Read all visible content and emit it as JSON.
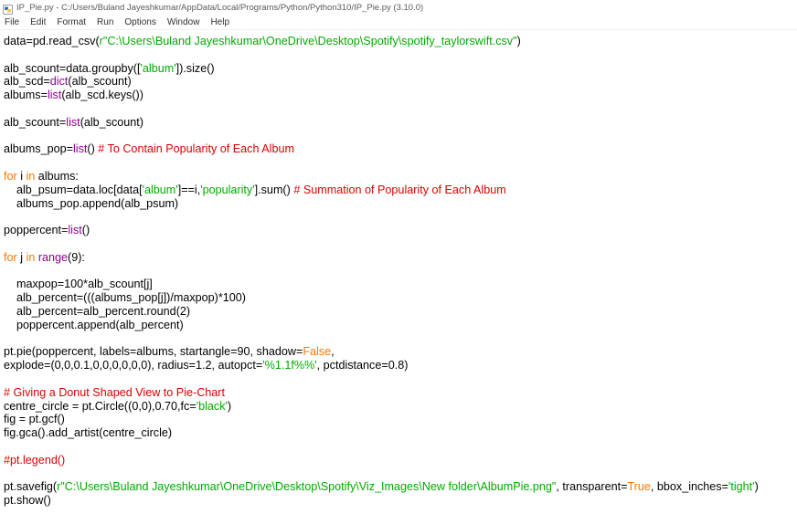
{
  "window": {
    "title": "IP_Pie.py - C:/Users/Buland Jayeshkumar/AppData/Local/Programs/Python/Python310/IP_Pie.py (3.10.0)"
  },
  "menu": {
    "items": [
      "File",
      "Edit",
      "Format",
      "Run",
      "Options",
      "Window",
      "Help"
    ]
  },
  "colors": {
    "keyword": "#ff7700",
    "builtin": "#900090",
    "string": "#00aa00",
    "comment": "#dd0000",
    "default": "#000000"
  },
  "code": {
    "lines": [
      [
        [
          "p",
          "data=pd.read_csv("
        ],
        [
          "s",
          "r\"C:\\Users\\Buland Jayeshkumar\\OneDrive\\Desktop\\Spotify\\spotify_taylorswift.csv\""
        ],
        [
          "p",
          ")"
        ]
      ],
      [],
      [
        [
          "p",
          "alb_scount=data.groupby(["
        ],
        [
          "s",
          "'album'"
        ],
        [
          "p",
          "]).size()"
        ]
      ],
      [
        [
          "p",
          "alb_scd="
        ],
        [
          "b",
          "dict"
        ],
        [
          "p",
          "(alb_scount)"
        ]
      ],
      [
        [
          "p",
          "albums="
        ],
        [
          "b",
          "list"
        ],
        [
          "p",
          "(alb_scd.keys())"
        ]
      ],
      [],
      [
        [
          "p",
          "alb_scount="
        ],
        [
          "b",
          "list"
        ],
        [
          "p",
          "(alb_scount)"
        ]
      ],
      [],
      [
        [
          "p",
          "albums_pop="
        ],
        [
          "b",
          "list"
        ],
        [
          "p",
          "() "
        ],
        [
          "c",
          "# To Contain Popularity of Each Album"
        ]
      ],
      [],
      [
        [
          "k",
          "for"
        ],
        [
          "p",
          " i "
        ],
        [
          "k",
          "in"
        ],
        [
          "p",
          " albums:"
        ]
      ],
      [
        [
          "p",
          "    alb_psum=data.loc[data["
        ],
        [
          "s",
          "'album'"
        ],
        [
          "p",
          "]==i,"
        ],
        [
          "s",
          "'popularity'"
        ],
        [
          "p",
          "].sum() "
        ],
        [
          "c",
          "# Summation of Popularity of Each Album"
        ]
      ],
      [
        [
          "p",
          "    albums_pop.append(alb_psum)"
        ]
      ],
      [],
      [
        [
          "p",
          "poppercent="
        ],
        [
          "b",
          "list"
        ],
        [
          "p",
          "()"
        ]
      ],
      [],
      [
        [
          "k",
          "for"
        ],
        [
          "p",
          " j "
        ],
        [
          "k",
          "in"
        ],
        [
          "p",
          " "
        ],
        [
          "b",
          "range"
        ],
        [
          "p",
          "(9):"
        ]
      ],
      [],
      [
        [
          "p",
          "    maxpop=100*alb_scount[j]"
        ]
      ],
      [
        [
          "p",
          "    alb_percent=(((albums_pop[j])/maxpop)*100)"
        ]
      ],
      [
        [
          "p",
          "    alb_percent=alb_percent.round(2)"
        ]
      ],
      [
        [
          "p",
          "    poppercent.append(alb_percent)"
        ]
      ],
      [],
      [
        [
          "p",
          "pt.pie(poppercent, labels=albums, startangle=90, shadow="
        ],
        [
          "k",
          "False"
        ],
        [
          "p",
          ","
        ]
      ],
      [
        [
          "p",
          "explode=(0,0,0.1,0,0,0,0,0,0), radius=1.2, autopct="
        ],
        [
          "s",
          "'%1.1f%%'"
        ],
        [
          "p",
          ", pctdistance=0.8)"
        ]
      ],
      [],
      [
        [
          "c",
          "# Giving a Donut Shaped View to Pie-Chart"
        ]
      ],
      [
        [
          "p",
          "centre_circle = pt.Circle((0,0),0.70,fc="
        ],
        [
          "s",
          "'black'"
        ],
        [
          "p",
          ")"
        ]
      ],
      [
        [
          "p",
          "fig = pt.gcf()"
        ]
      ],
      [
        [
          "p",
          "fig.gca().add_artist(centre_circle)"
        ]
      ],
      [],
      [
        [
          "c",
          "#pt.legend()"
        ]
      ],
      [],
      [
        [
          "p",
          "pt.savefig("
        ],
        [
          "s",
          "r\"C:\\Users\\Buland Jayeshkumar\\OneDrive\\Desktop\\Spotify\\Viz_Images\\New folder\\AlbumPie.png\""
        ],
        [
          "p",
          ", transparent="
        ],
        [
          "k",
          "True"
        ],
        [
          "p",
          ", bbox_inches="
        ],
        [
          "s",
          "'tight'"
        ],
        [
          "p",
          ")"
        ]
      ],
      [
        [
          "p",
          "pt.show()"
        ]
      ]
    ]
  }
}
